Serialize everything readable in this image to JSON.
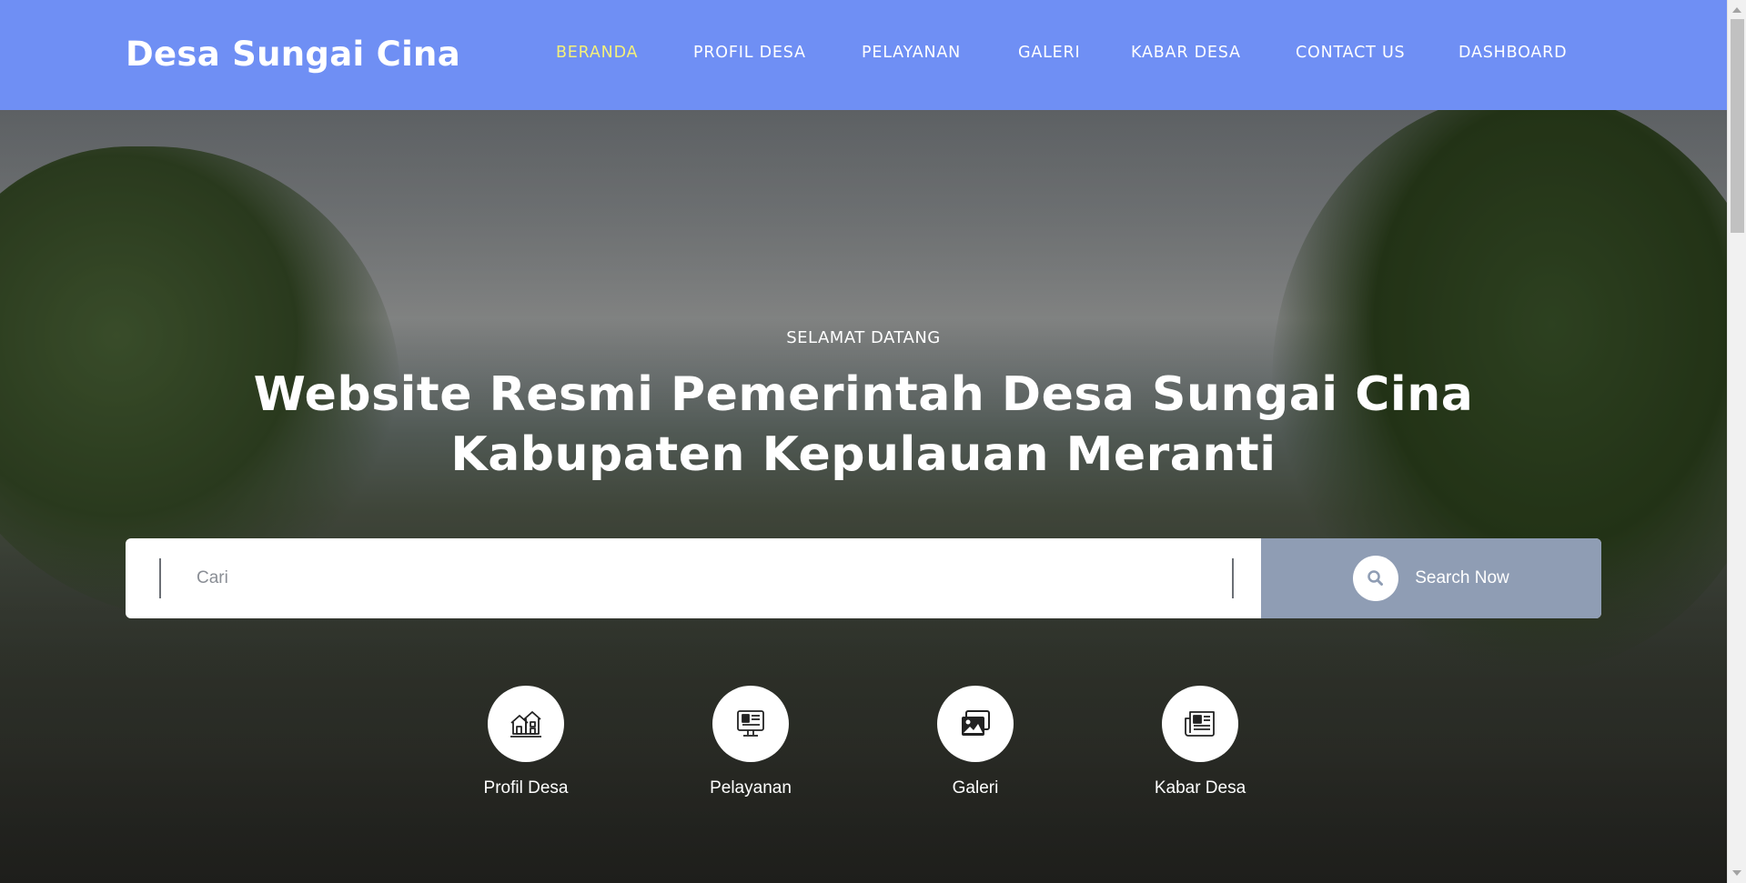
{
  "header": {
    "brand": "Desa Sungai Cina",
    "nav": [
      {
        "label": "BERANDA",
        "active": true
      },
      {
        "label": "PROFIL DESA",
        "active": false
      },
      {
        "label": "PELAYANAN",
        "active": false
      },
      {
        "label": "GALERI",
        "active": false
      },
      {
        "label": "KABAR DESA",
        "active": false
      },
      {
        "label": "CONTACT US",
        "active": false
      },
      {
        "label": "DASHBOARD",
        "active": false
      }
    ]
  },
  "hero": {
    "welcome": "SELAMAT DATANG",
    "headline_line1": "Website Resmi Pemerintah Desa Sungai Cina",
    "headline_line2": "Kabupaten Kepulauan Meranti"
  },
  "search": {
    "placeholder": "Cari",
    "button_label": "Search Now",
    "button_icon": "search-icon"
  },
  "quick_links": [
    {
      "label": "Profil Desa",
      "icon": "village-houses-icon"
    },
    {
      "label": "Pelayanan",
      "icon": "service-monitor-icon"
    },
    {
      "label": "Galeri",
      "icon": "gallery-images-icon"
    },
    {
      "label": "Kabar Desa",
      "icon": "newspaper-icon"
    }
  ],
  "colors": {
    "header_bg": "#6f8ff4",
    "nav_active": "#f4f07a",
    "search_button_bg": "#8f9db4"
  }
}
